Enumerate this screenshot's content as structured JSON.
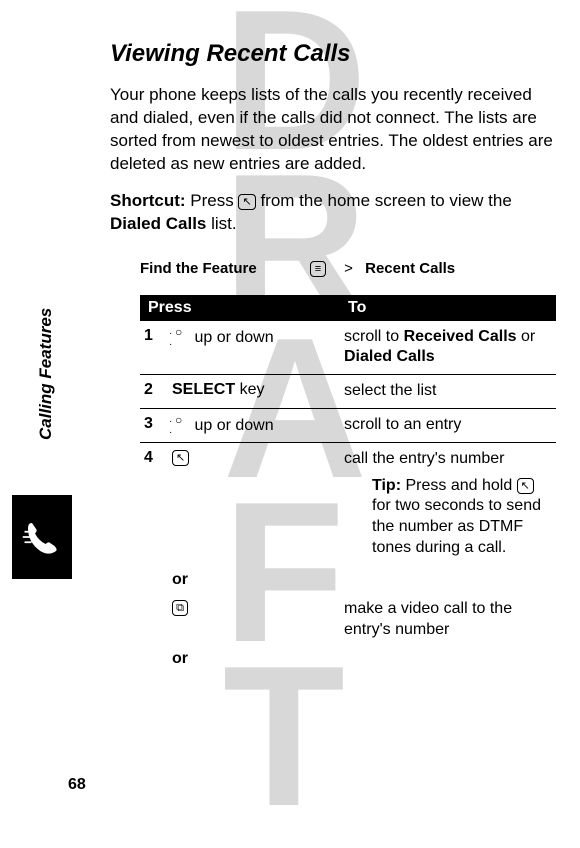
{
  "watermark": {
    "d": "D",
    "r": "R",
    "a": "A",
    "f": "F",
    "t": "T"
  },
  "title": "Viewing Recent Calls",
  "intro": "Your phone keeps lists of the calls you recently received and dialed, even if the calls did not connect. The lists are sorted from newest to oldest entries. The oldest entries are deleted as new entries are added.",
  "shortcut": {
    "label": "Shortcut:",
    "before": "Press",
    "icon": "send-key-icon",
    "after1": "from the home screen to view the",
    "listname": "Dialed Calls",
    "after2": "list."
  },
  "find_feature": {
    "label": "Find the Feature",
    "menu_icon": "menu-key-icon",
    "gt": ">",
    "target": "Recent Calls"
  },
  "table": {
    "header_press": "Press",
    "header_to": "To",
    "rows": [
      {
        "num": "1",
        "press": "up or down",
        "press_icon": "nav-icon",
        "to_pre": "scroll to ",
        "to_b1": "Received Calls",
        "to_mid": " or ",
        "to_b2": "Dialed Calls"
      },
      {
        "num": "2",
        "press_b": "SELECT",
        "press_after": " key",
        "to": "select the list"
      },
      {
        "num": "3",
        "press": "up or down",
        "press_icon": "nav-icon",
        "to": "scroll to an entry"
      },
      {
        "num": "4",
        "press_icon_only": "send-key-icon",
        "to": "call the entry's number",
        "tip_label": "Tip:",
        "tip_before": "Press and hold",
        "tip_icon": "send-key-icon",
        "tip_after": "for two seconds to send the number as DTMF tones during a call."
      }
    ],
    "or": "or",
    "video_icon": "video-key-icon",
    "video_to": "make a video call to the entry's number"
  },
  "side_label": "Calling Features",
  "icons": {
    "send_glyph": "↖",
    "menu_glyph": "≡",
    "video_glyph": "⧉"
  },
  "page_num": "68"
}
